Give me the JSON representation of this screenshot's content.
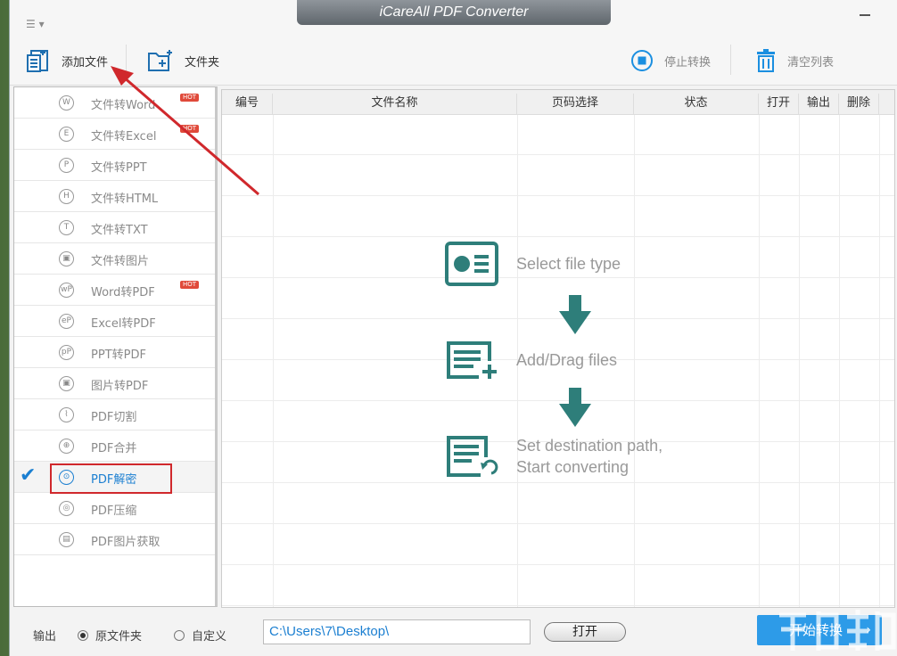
{
  "window": {
    "title": "iCareAll PDF Converter"
  },
  "toolbar": {
    "add_file": "添加文件",
    "folder": "文件夹",
    "stop": "停止转换",
    "clear": "清空列表"
  },
  "sidebar": {
    "hot_badge": "HOT",
    "items": [
      {
        "label": "文件转Word",
        "icon": "W",
        "hot": true
      },
      {
        "label": "文件转Excel",
        "icon": "E",
        "hot": true
      },
      {
        "label": "文件转PPT",
        "icon": "P",
        "hot": false
      },
      {
        "label": "文件转HTML",
        "icon": "H",
        "hot": false
      },
      {
        "label": "文件转TXT",
        "icon": "T",
        "hot": false
      },
      {
        "label": "文件转图片",
        "icon": "▣",
        "hot": false
      },
      {
        "label": "Word转PDF",
        "icon": "wP",
        "hot": true
      },
      {
        "label": "Excel转PDF",
        "icon": "eP",
        "hot": false
      },
      {
        "label": "PPT转PDF",
        "icon": "pP",
        "hot": false
      },
      {
        "label": "图片转PDF",
        "icon": "▣",
        "hot": false
      },
      {
        "label": "PDF切割",
        "icon": "⌇",
        "hot": false
      },
      {
        "label": "PDF合并",
        "icon": "⊕",
        "hot": false
      },
      {
        "label": "PDF解密",
        "icon": "⊙",
        "hot": false,
        "active": true
      },
      {
        "label": "PDF压缩",
        "icon": "◎",
        "hot": false
      },
      {
        "label": "PDF图片获取",
        "icon": "▤",
        "hot": false
      }
    ]
  },
  "table": {
    "columns": [
      "编号",
      "文件名称",
      "页码选择",
      "状态",
      "打开",
      "输出",
      "删除"
    ]
  },
  "steps": {
    "step1": "Select file type",
    "step2": "Add/Drag files",
    "step3_line1": "Set destination path,",
    "step3_line2": "Start converting"
  },
  "footer": {
    "output_label": "输出",
    "radio_original": "原文件夹",
    "radio_custom": "自定义",
    "path_value": "C:\\Users\\7\\Desktop\\",
    "open_button": "打开",
    "start_button": "开始转换"
  },
  "colors": {
    "accent": "#2d9be8",
    "teal": "#2e7e7a",
    "active_blue": "#1b7fd1",
    "annotation_red": "#d0282c"
  }
}
